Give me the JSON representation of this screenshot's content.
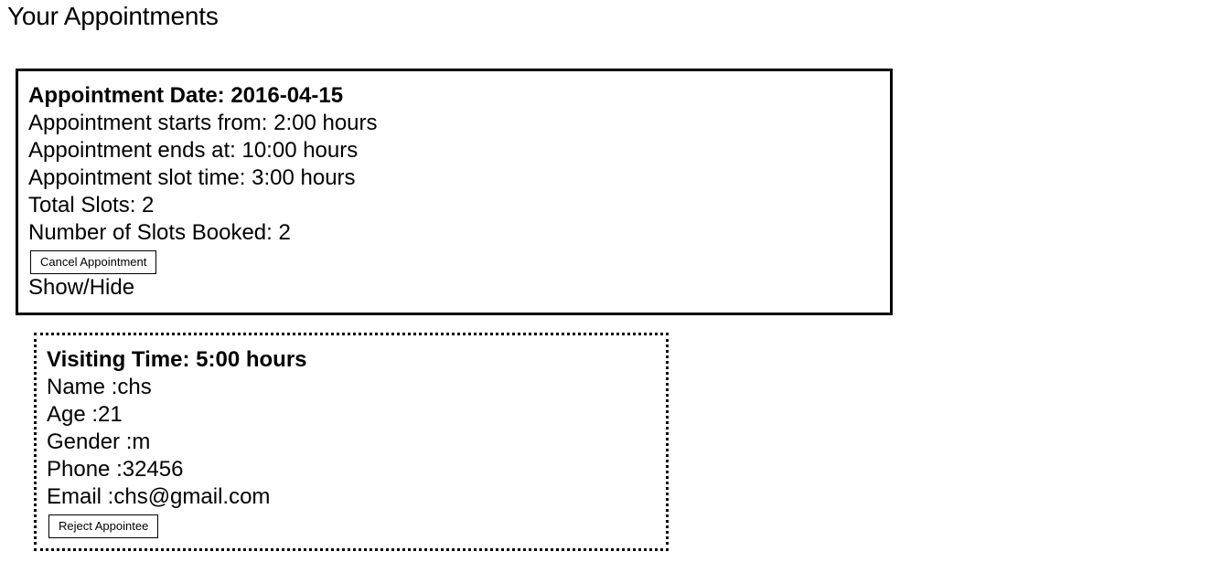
{
  "page": {
    "title": "Your Appointments"
  },
  "appointment": {
    "date_label": "Appointment Date: 2016-04-15",
    "starts_label": "Appointment starts from: 2:00 hours",
    "ends_label": "Appointment ends at: 10:00 hours",
    "slot_time_label": "Appointment slot time: 3:00 hours",
    "total_slots_label": "Total Slots: 2",
    "booked_label": "Number of Slots Booked: 2",
    "cancel_button": "Cancel Appointment",
    "toggle_label": "Show/Hide"
  },
  "appointee": {
    "visiting_time_label": "Visiting Time: 5:00 hours",
    "name_label": "Name :chs",
    "age_label": "Age :21",
    "gender_label": "Gender :m",
    "phone_label": "Phone :32456",
    "email_label": "Email :chs@gmail.com",
    "reject_button": "Reject Appointee"
  }
}
